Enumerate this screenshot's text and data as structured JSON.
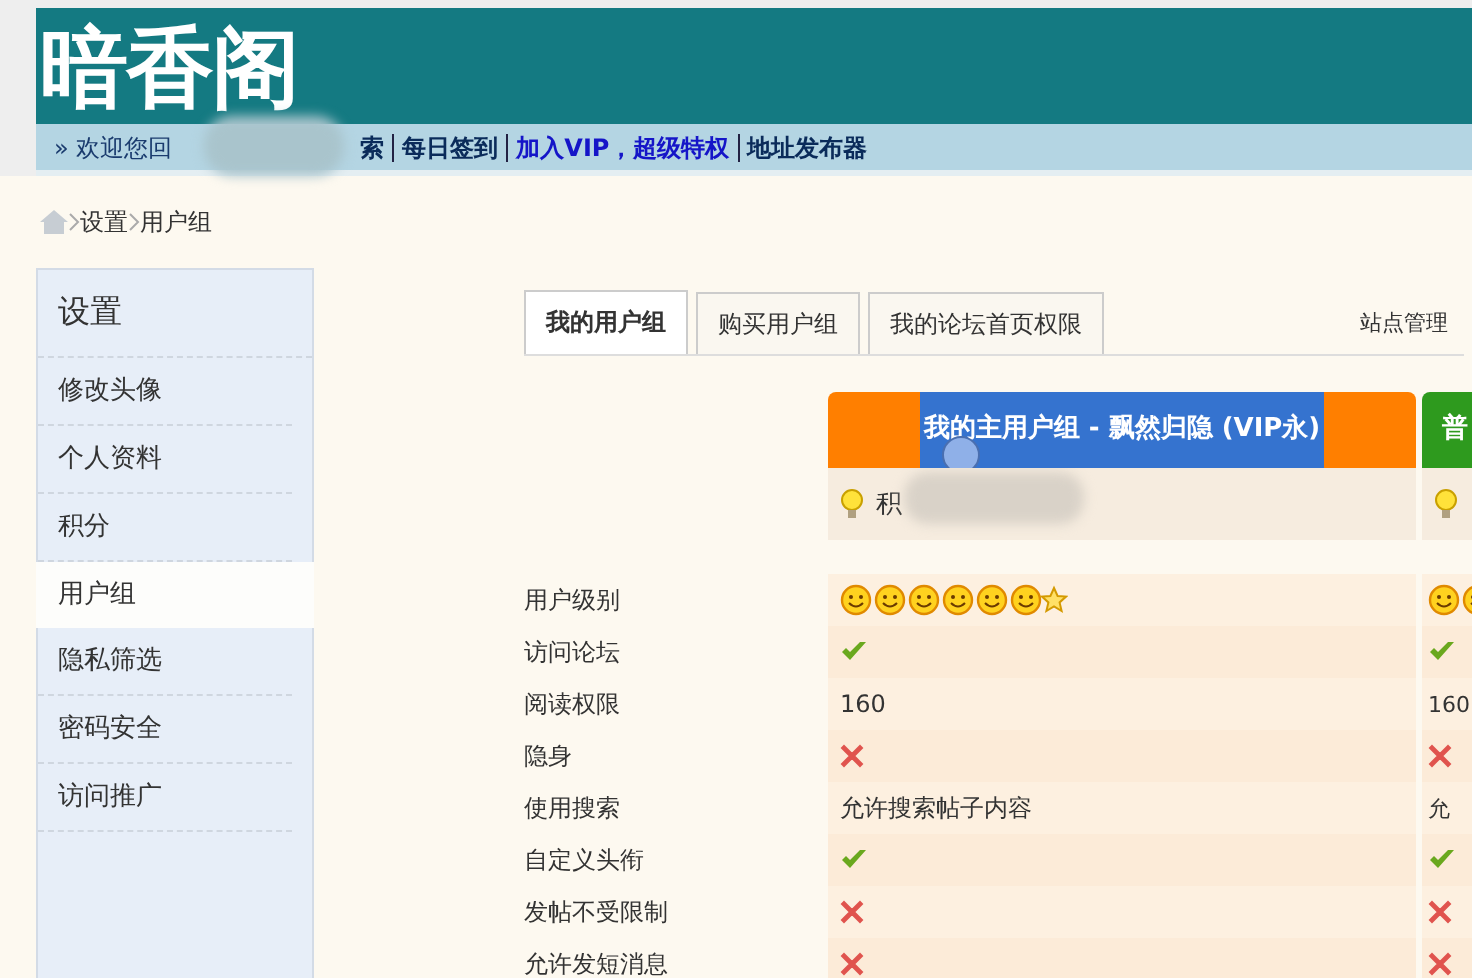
{
  "site": {
    "logo": "暗香阁"
  },
  "nav": [
    {
      "text": "» 欢迎您回",
      "kind": "plain"
    },
    {
      "text": "索",
      "kind": "link"
    },
    {
      "text": "每日签到",
      "kind": "link"
    },
    {
      "text": "加入VIP，超级特权",
      "kind": "vip"
    },
    {
      "text": "地址发布器",
      "kind": "link"
    }
  ],
  "breadcrumb": [
    "设置",
    "用户组"
  ],
  "sidebar": {
    "title": "设置",
    "items": [
      {
        "label": "修改头像",
        "selected": false
      },
      {
        "label": "个人资料",
        "selected": false
      },
      {
        "label": "积分",
        "selected": false
      },
      {
        "label": "用户组",
        "selected": true
      },
      {
        "label": "隐私筛选",
        "selected": false
      },
      {
        "label": "密码安全",
        "selected": false
      },
      {
        "label": "访问推广",
        "selected": false
      }
    ]
  },
  "tabs": [
    {
      "label": "我的用户组",
      "selected": true
    },
    {
      "label": "购买用户组",
      "selected": false
    },
    {
      "label": "我的论坛首页权限",
      "selected": false
    }
  ],
  "admin_link": "站点管理",
  "groups": [
    {
      "title": "我的主用户组 - 飘然归隐 (VIP永)",
      "color": "#ff7f00",
      "highlighted": true,
      "subtitle": "积"
    },
    {
      "title": "普",
      "color": "#2e9a1e",
      "highlighted": false
    }
  ],
  "rows": [
    {
      "label": "用户级别",
      "values": [
        {
          "kind": "rank"
        },
        {
          "kind": "rank"
        }
      ]
    },
    {
      "label": "访问论坛",
      "values": [
        {
          "kind": "check"
        },
        {
          "kind": "check"
        }
      ]
    },
    {
      "label": "阅读权限",
      "values": [
        {
          "kind": "text",
          "text": "160"
        },
        {
          "kind": "text",
          "text": "160"
        }
      ]
    },
    {
      "label": "隐身",
      "values": [
        {
          "kind": "cross"
        },
        {
          "kind": "cross"
        }
      ]
    },
    {
      "label": "使用搜索",
      "values": [
        {
          "kind": "text",
          "text": "允许搜索帖子内容"
        },
        {
          "kind": "text",
          "text": "允"
        }
      ]
    },
    {
      "label": "自定义头衔",
      "values": [
        {
          "kind": "check"
        },
        {
          "kind": "check"
        }
      ]
    },
    {
      "label": "发帖不受限制",
      "values": [
        {
          "kind": "cross"
        },
        {
          "kind": "cross"
        }
      ]
    },
    {
      "label": "允许发短消息",
      "values": [
        {
          "kind": "cross"
        },
        {
          "kind": "cross"
        }
      ]
    }
  ]
}
